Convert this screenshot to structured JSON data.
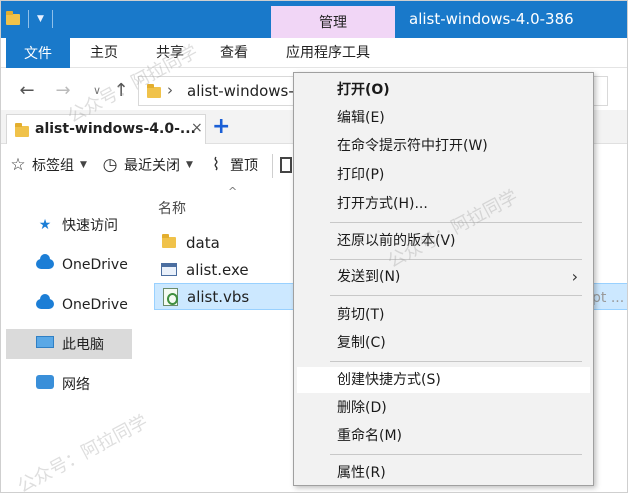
{
  "window": {
    "title": "alist-windows-4.0-386",
    "context_tab": "管理"
  },
  "ribbon": {
    "tabs": [
      "文件",
      "主页",
      "共享",
      "查看",
      "应用程序工具"
    ]
  },
  "address": {
    "path": "alist-windows-4.0-386"
  },
  "tabstrip": {
    "tab_label": "alist-windows-4.0-...",
    "close_glyph": "×",
    "new_tab_glyph": "+"
  },
  "toolbar": {
    "bookmarks_label": "标签组",
    "recently_closed_label": "最近关闭",
    "pin_label": "置顶"
  },
  "sidebar": {
    "items": [
      {
        "label": "快速访问",
        "icon": "star-icon"
      },
      {
        "label": "OneDrive",
        "icon": "cloud-icon"
      },
      {
        "label": "OneDrive",
        "icon": "cloud-icon"
      },
      {
        "label": "此电脑",
        "icon": "computer-icon",
        "selected": true
      },
      {
        "label": "网络",
        "icon": "network-icon"
      }
    ]
  },
  "content": {
    "column_name": "名称",
    "files": [
      {
        "name": "data",
        "icon": "folder-icon"
      },
      {
        "name": "alist.exe",
        "icon": "exe-icon"
      },
      {
        "name": "alist.vbs",
        "icon": "vbs-script-icon",
        "selected": true
      }
    ],
    "type_fragment": "pt ..."
  },
  "context_menu": {
    "items": [
      {
        "label": "打开(O)",
        "bold": true
      },
      {
        "label": "编辑(E)"
      },
      {
        "label": "在命令提示符中打开(W)"
      },
      {
        "label": "打印(P)"
      },
      {
        "label": "打开方式(H)..."
      },
      {
        "label": "还原以前的版本(V)"
      },
      {
        "label": "发送到(N)",
        "submenu": true
      },
      {
        "label": "剪切(T)"
      },
      {
        "label": "复制(C)"
      },
      {
        "label": "创建快捷方式(S)",
        "hover": true
      },
      {
        "label": "删除(D)"
      },
      {
        "label": "重命名(M)"
      },
      {
        "label": "属性(R)"
      }
    ],
    "submenu_glyph": "›"
  },
  "watermark": {
    "text": "公众号：阿拉同学"
  },
  "colors": {
    "titlebar": "#1979ca",
    "context_tab": "#f1d6f6",
    "selection": "#cce8ff",
    "menu_bg": "#f2f2f2"
  }
}
